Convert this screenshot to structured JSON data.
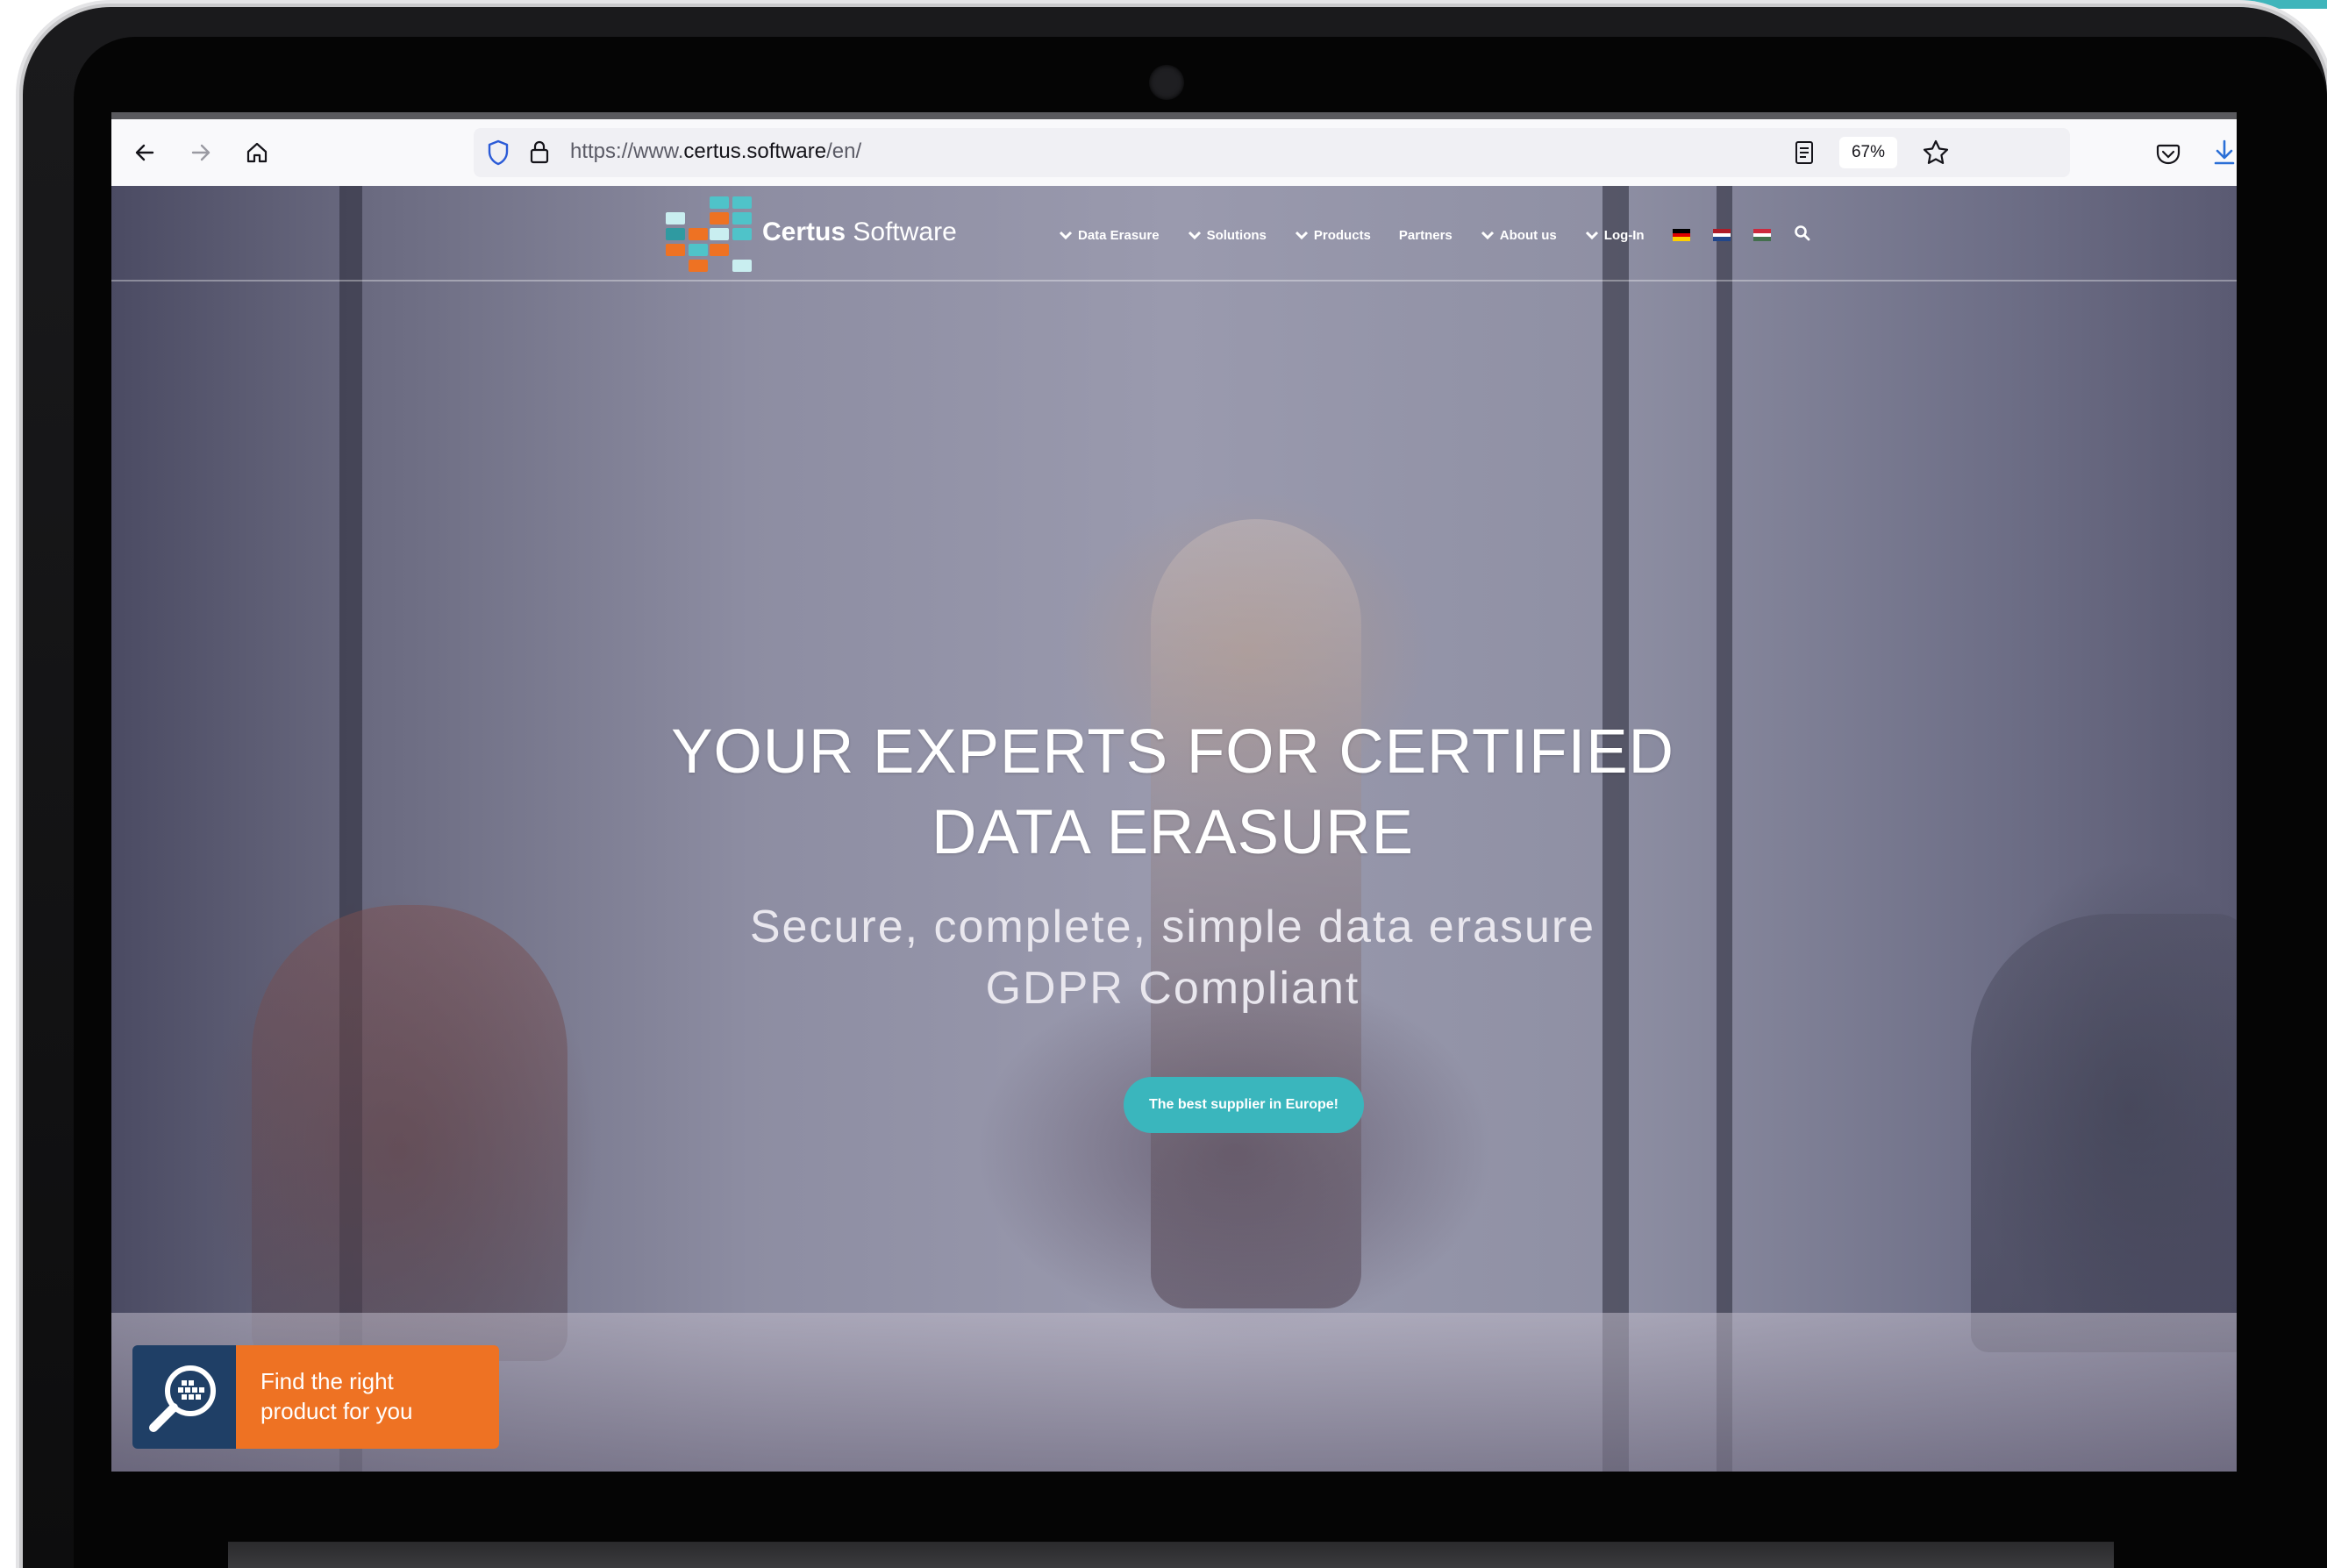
{
  "browser": {
    "url_prefix": "https://www.",
    "url_domain": "certus.software",
    "url_path": "/en/",
    "zoom": "67%"
  },
  "site": {
    "logo_bold": "Certus",
    "logo_light": "Software",
    "nav": [
      {
        "label": "Data Erasure"
      },
      {
        "label": "Solutions"
      },
      {
        "label": "Products"
      },
      {
        "label": "Partners"
      },
      {
        "label": "About us"
      },
      {
        "label": "Log-In"
      }
    ],
    "hero": {
      "title": "YOUR EXPERTS FOR CERTIFIED DATA ERASURE",
      "subtitle_line1": "Secure, complete, simple data erasure",
      "subtitle_line2": "GDPR Compliant",
      "cta": "The best supplier in Europe!"
    },
    "finder": {
      "line1": "Find the right",
      "line2": "product for you"
    }
  },
  "colors": {
    "accent_teal": "#3ab6bd",
    "accent_orange": "#ee7223",
    "finder_navy": "#1f3f66"
  }
}
